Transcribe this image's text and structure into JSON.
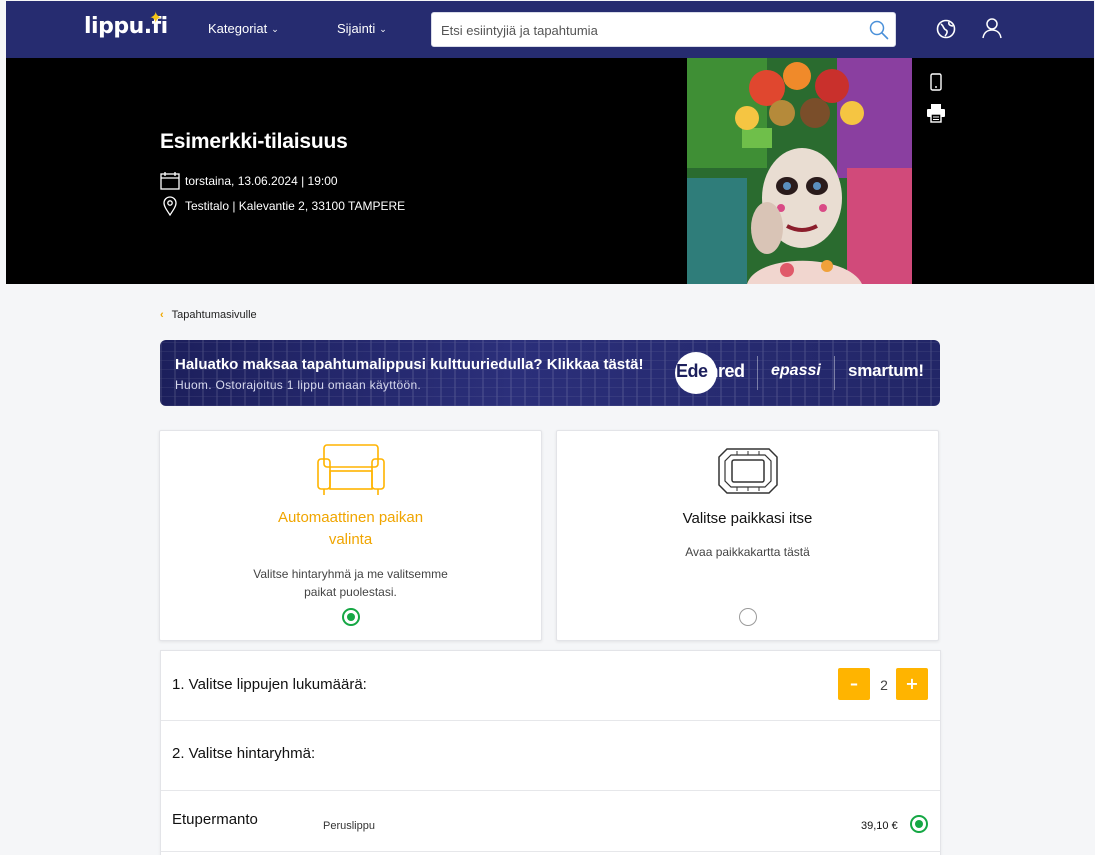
{
  "header": {
    "logo_text": "lippu.fi",
    "nav": [
      {
        "label": "Kategoriat"
      },
      {
        "label": "Sijainti"
      }
    ],
    "search_placeholder": "Etsi esiintyjiä ja tapahtumia",
    "icons": [
      "globe-icon",
      "user-icon",
      "search-icon"
    ]
  },
  "event": {
    "title": "Esimerkki-tilaisuus",
    "date": "torstaina, 13.06.2024 | 19:00",
    "location": "Testitalo | Kalevantie 2, 33100 TAMPERE",
    "side_icons": [
      "mobile-icon",
      "print-icon"
    ]
  },
  "back_link": "Tapahtumasivulle",
  "banner": {
    "heading": "Haluatko maksaa tapahtumalippusi kulttuuriedulla? Klikkaa tästä!",
    "subtext": "Huom. Ostorajoitus 1 lippu omaan käyttöön.",
    "partners": [
      "Edenred",
      "epassi",
      "smartum!"
    ]
  },
  "seat_options": [
    {
      "title": "Automaattinen paikan valinta",
      "description": "Valitse hintaryhmä ja me valitsemme paikat puolestasi.",
      "selected": true,
      "icon": "sofa-icon"
    },
    {
      "title": "Valitse paikkasi itse",
      "description": "Avaa paikkakartta tästä",
      "selected": false,
      "icon": "seat-map-icon"
    }
  ],
  "step1": {
    "label": "1. Valitse lippujen lukumäärä:",
    "quantity": "2",
    "minus": "–",
    "plus": "+"
  },
  "step2": {
    "label": "2. Valitse hintaryhmä:"
  },
  "price_rows": [
    {
      "zone": "Etupermanto",
      "ticket_type": "Peruslippu",
      "price": "39,10 €",
      "selected": true
    }
  ],
  "colors": {
    "nav_bg": "#262c70",
    "accent": "#ffb400",
    "selected": "#15a744"
  }
}
